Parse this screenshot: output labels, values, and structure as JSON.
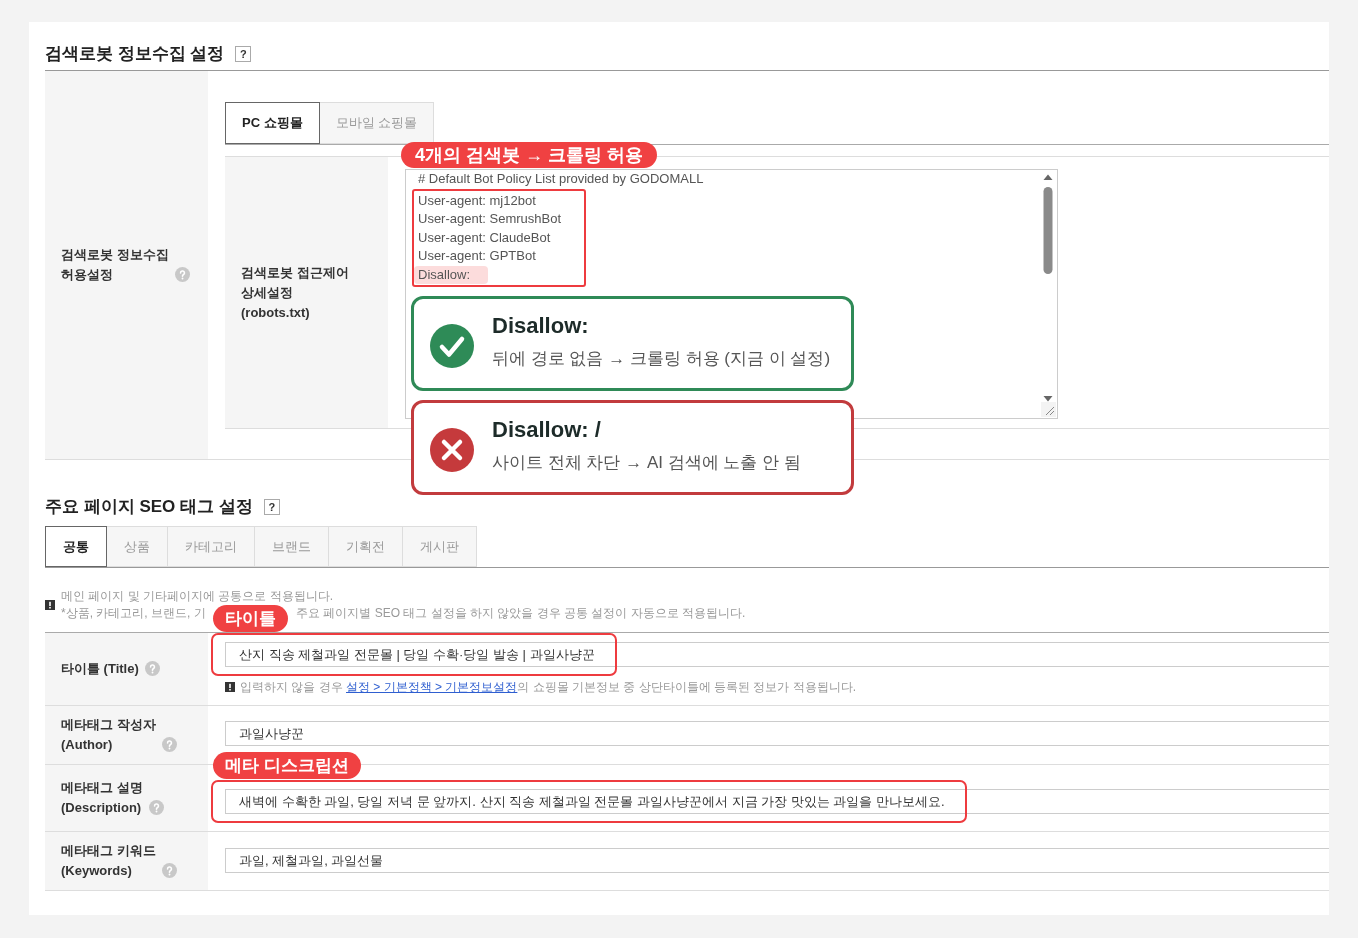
{
  "robots_section": {
    "title": "검색로봇 정보수집 설정",
    "help": "?",
    "setting_label": [
      "검색로봇 정보수집",
      "허용설정"
    ],
    "tabs": [
      {
        "label": "PC 쇼핑몰",
        "selected": true
      },
      {
        "label": "모바일 쇼핑몰",
        "selected": false
      }
    ],
    "detail_label": [
      "검색로봇 접근제어",
      "상세설정",
      "(robots.txt)"
    ],
    "lines": [
      {
        "text": "# Default Bot Policy List provided by GODOMALL",
        "framed": false,
        "highlighted": false
      },
      {
        "text": "User-agent: mj12bot",
        "framed": true,
        "highlighted": false
      },
      {
        "text": "User-agent: SemrushBot",
        "framed": true,
        "highlighted": false
      },
      {
        "text": "User-agent: ClaudeBot",
        "framed": true,
        "highlighted": false
      },
      {
        "text": "User-agent: GPTBot",
        "framed": true,
        "highlighted": false
      },
      {
        "text": "Disallow:",
        "framed": true,
        "highlighted": true
      }
    ],
    "badge": "4개의 검색봇 → 크롤링 허용",
    "callouts": [
      {
        "kind": "allow",
        "title": "Disallow:",
        "text": "뒤에 경로 없음 → 크롤링 허용 (지금 이 설정)"
      },
      {
        "kind": "block",
        "title": "Disallow: /",
        "text": "사이트 전체 차단 → AI 검색에 노출 안 됨"
      }
    ]
  },
  "seo_section": {
    "title": "주요 페이지 SEO 태그 설정",
    "help": "?",
    "tabs": [
      {
        "label": "공통",
        "selected": true
      },
      {
        "label": "상품",
        "selected": false
      },
      {
        "label": "카테고리",
        "selected": false
      },
      {
        "label": "브랜드",
        "selected": false
      },
      {
        "label": "기획전",
        "selected": false
      },
      {
        "label": "게시판",
        "selected": false
      }
    ],
    "notice": {
      "line_1": "메인 페이지 및 기타페이지에 공통으로 적용됩니다.",
      "line_2_parts": [
        "*상품, 카테고리, 브랜드, 기",
        "주요 페이지별 SEO 태그 설정을 하지 않았을 경우 공통 설정이 자동으로 적용됩니다."
      ]
    },
    "rows": [
      {
        "label": [
          "타이틀 (Title)"
        ],
        "value": "산지 직송 제철과일 전문몰 | 당일 수확·당일 발송 | 과일사냥꾼",
        "framed": true,
        "badge": "타이틀",
        "hint": {
          "before": "입력하지 않을 경우 ",
          "link": "설정 > 기본정책 > 기본정보설정",
          "after": "의 쇼핑몰 기본정보 중 상단타이틀에 등록된 정보가 적용됩니다."
        }
      },
      {
        "label": [
          "메타태그 작성자",
          "(Author)"
        ],
        "value": "과일사냥꾼",
        "framed": false
      },
      {
        "label": [
          "메타태그 설명",
          "(Description)"
        ],
        "value": "새벽에 수확한 과일, 당일 저녁 문 앞까지. 산지 직송 제철과일 전문몰 과일사냥꾼에서 지금 가장 맛있는 과일을 만나보세요.",
        "framed": true,
        "badge": "메타 디스크립션"
      },
      {
        "label": [
          "메타태그 키워드",
          "(Keywords)"
        ],
        "value": "과일, 제철과일, 과일선물",
        "framed": false
      }
    ]
  }
}
